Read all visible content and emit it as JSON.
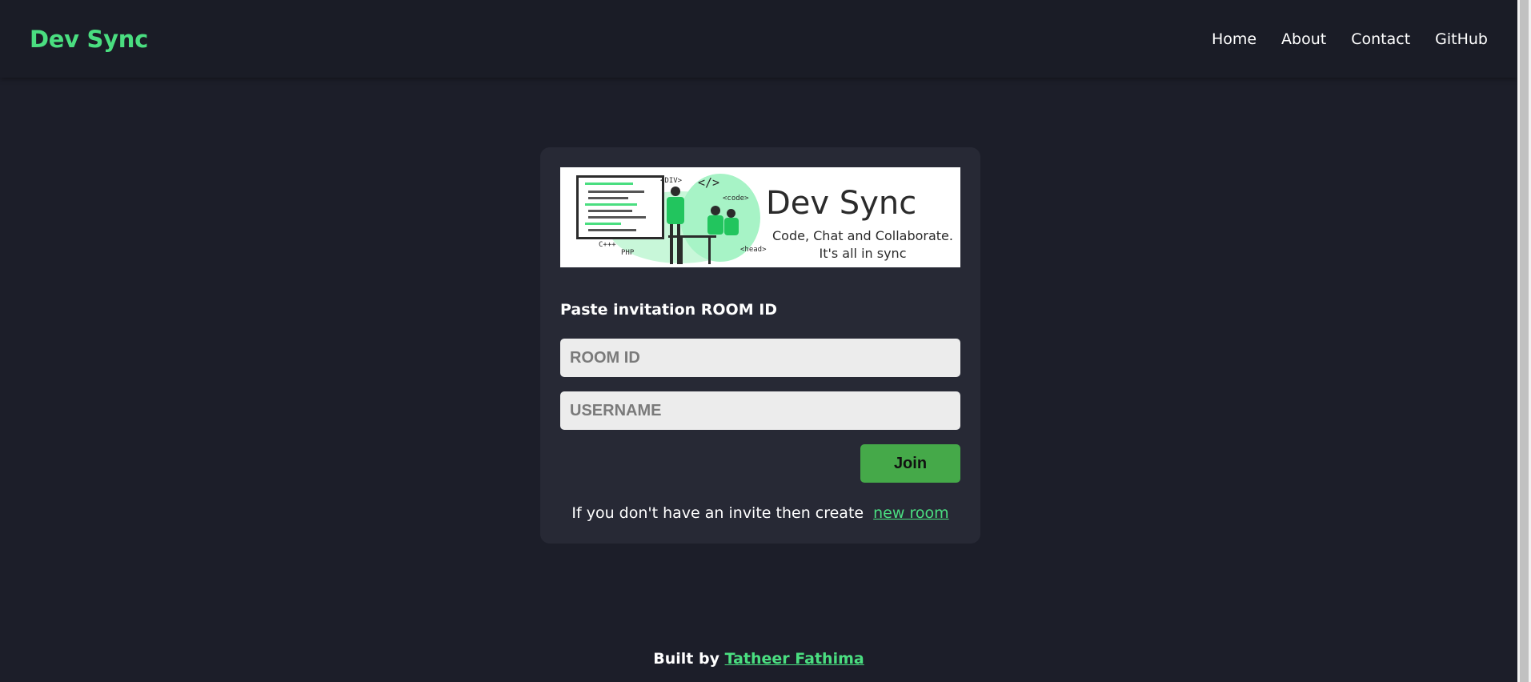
{
  "nav": {
    "brand": "Dev Sync",
    "links": [
      "Home",
      "About",
      "Contact",
      "GitHub"
    ]
  },
  "banner": {
    "title": "Dev Sync",
    "subtitle_line1": "Code, Chat and Collaborate.",
    "subtitle_line2": "It's all in sync",
    "tags": [
      "<DIV>",
      "</>",
      "<code>",
      "C+++",
      "PHP",
      "<head>"
    ]
  },
  "form": {
    "label": "Paste invitation ROOM ID",
    "room_placeholder": "ROOM ID",
    "room_value": "",
    "username_placeholder": "USERNAME",
    "username_value": "",
    "join_label": "Join",
    "create_text": "If you don't have an invite then create",
    "create_link": "new room"
  },
  "footer": {
    "prefix": "Built by",
    "author": "Tatheer Fathima"
  },
  "colors": {
    "accent": "#4ade80",
    "button": "#45a949",
    "background": "#1c1e29",
    "card": "#272935"
  }
}
